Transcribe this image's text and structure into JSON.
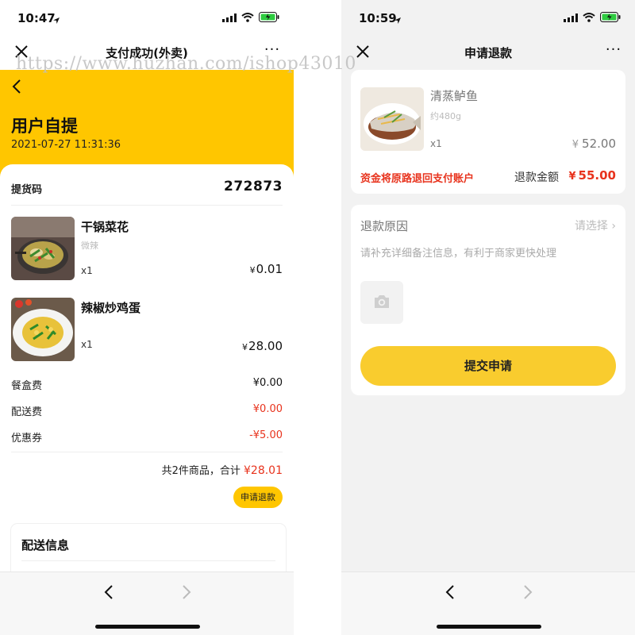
{
  "watermark": "https://www.huzhan.com/ishop43010",
  "left_screen": {
    "status_time": "10:47",
    "nav_title": "支付成功(外卖)",
    "more": "···",
    "hero_title": "用户自提",
    "hero_time": "2021-07-27 11:31:36",
    "pickup_label": "提货码",
    "pickup_code": "272873",
    "items": [
      {
        "name": "干锅菜花",
        "spec": "微辣",
        "qty": "x1",
        "currency": "¥",
        "price": "0.01"
      },
      {
        "name": "辣椒炒鸡蛋",
        "spec": "",
        "qty": "x1",
        "currency": "¥",
        "price": "28.00"
      }
    ],
    "fees": [
      {
        "label": "餐盒费",
        "value": "¥0.00"
      },
      {
        "label": "配送费",
        "value": "¥0.00"
      },
      {
        "label": "优惠券",
        "value": "-¥5.00"
      }
    ],
    "summary_text": "共2件商品，合计",
    "summary_amount": "¥28.01",
    "refund_button": "申请退款",
    "delivery_title": "配送信息"
  },
  "right_screen": {
    "status_time": "10:59",
    "nav_title": "申请退款",
    "more": "···",
    "product": {
      "name": "清蒸鲈鱼",
      "spec": "约480g",
      "qty": "x1",
      "currency": "¥",
      "price": "52.00"
    },
    "refund_note": "资金将原路退回支付账户",
    "refund_amount_label": "退款金额",
    "refund_amount_currency": "¥",
    "refund_amount": "55.00",
    "reason_label": "退款原因",
    "reason_placeholder": "请选择 ›",
    "remark_hint": "请补充详细备注信息，有利于商家更快处理",
    "submit_button": "提交申请"
  },
  "colors": {
    "brand_yellow": "#ffc600",
    "button_yellow": "#f9cc2e",
    "price_red": "#e8331d"
  },
  "icons": [
    "close-icon",
    "more-icon",
    "back-icon",
    "forward-icon",
    "camera-icon",
    "signal-icon",
    "wifi-icon",
    "battery-icon",
    "location-arrow-icon"
  ]
}
